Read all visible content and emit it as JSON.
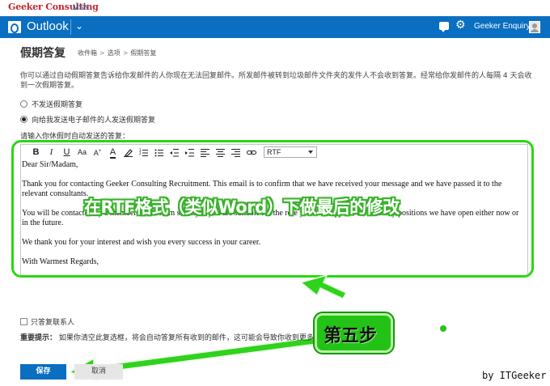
{
  "brand": {
    "logo": "Geeker Consulting",
    "msn": "MSN"
  },
  "header": {
    "app_title": "Outlook",
    "user_name": "Geeker Enquiry"
  },
  "page": {
    "title": "假期答复",
    "breadcrumb": [
      "收件箱",
      "选项",
      "假期答复"
    ],
    "description": "你可以通过自动假期答复告诉给你发邮件的人你现在无法回复邮件。所发邮件被转到垃圾邮件文件夹的发件人不会收到答复。经常给你发邮件的人每隔 4 天会收到一次假期答复。",
    "options": [
      {
        "label": "不发送假期答复",
        "selected": false
      },
      {
        "label": "向给我发送电子邮件的人发送假期答复",
        "selected": true
      }
    ],
    "prompt": "请输入你休假时自动发送的答复："
  },
  "editor": {
    "format_value": "RTF",
    "paragraphs": [
      "Dear Sir/Madam,",
      "Thank you for contacting Geeker Consulting Recruitment. This email is to confirm that we have received your message and we have passed it to the relevant consultants.",
      "You will be contacted by a member of the team shortly if you are suitable for the role you have applied to, or to any positions we have open either now or in the future.",
      "We thank you for your interest and wish you every success in your career.",
      "With Warmest Regards,"
    ]
  },
  "annotations": {
    "overlay_text": "在RTF格式（类似Word）下做最后的修改",
    "step_label": "第五步",
    "watermark": "by ITGeeker",
    "color": "#2ad614"
  },
  "footer": {
    "checkbox_label": "只答复联系人",
    "notice_prefix": "重要提示：",
    "notice_text": "如果你清空此复选框，将会自动答复所有收到的邮件，这可能会导致你收到更多",
    "save_label": "保存",
    "cancel_label": "取消"
  },
  "colors": {
    "accent": "#0a6ec1",
    "brand": "#c0272d"
  }
}
